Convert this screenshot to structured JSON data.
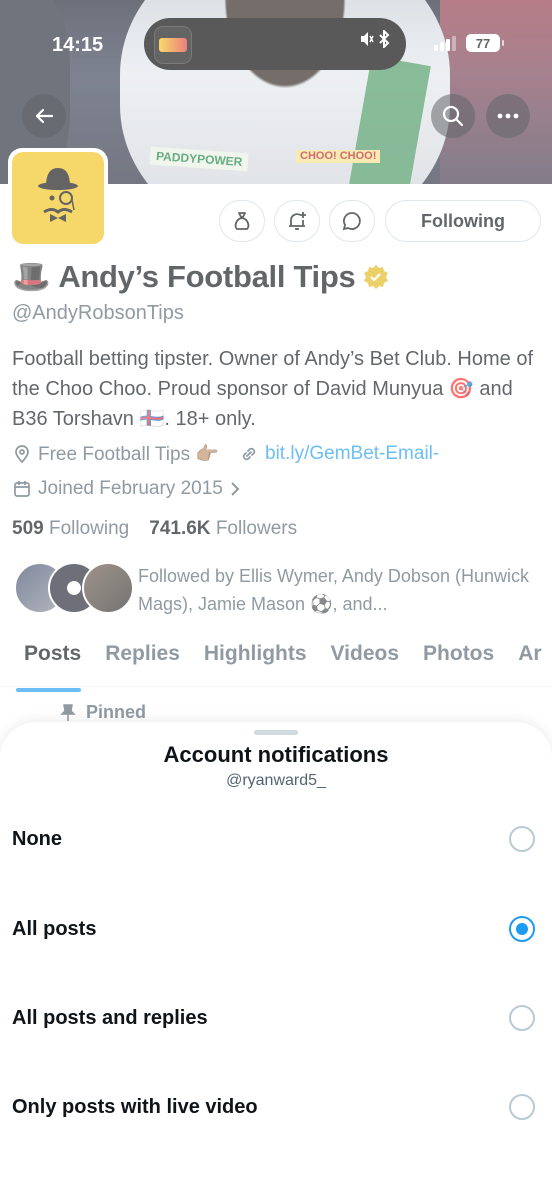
{
  "status_bar": {
    "time": "14:15",
    "battery": "77"
  },
  "profile": {
    "emoji": "🎩",
    "name": "Andy’s Football Tips",
    "handle": "@AndyRobsonTips",
    "bio": "Football betting tipster. Owner of Andy’s Bet Club. Home of the Choo Choo. Proud sponsor of David Munyua 🎯 and B36 Torshavn 🇫🇴. 18+ only.",
    "location": "Free Football Tips 👉🏽",
    "website": "bit.ly/GemBet-Email-",
    "joined": "Joined February 2015",
    "following_count": "509",
    "following_label": "Following",
    "followers_count": "741.6K",
    "followers_label": "Followers",
    "followed_by": "Followed by Ellis Wymer, Andy Dobson (Hunwick Mags), Jamie Mason ⚽, and..."
  },
  "banner": {
    "shirt_sponsor": "PADDYPOWER",
    "sign_text": "CHOO! CHOO!"
  },
  "actions": {
    "following_label": "Following"
  },
  "tabs": [
    "Posts",
    "Replies",
    "Highlights",
    "Videos",
    "Photos",
    "Ar"
  ],
  "active_tab": "Posts",
  "pinned_label": "Pinned",
  "sheet": {
    "title": "Account notifications",
    "subtitle": "@ryanward5_",
    "options": [
      {
        "label": "None",
        "selected": false
      },
      {
        "label": "All posts",
        "selected": true
      },
      {
        "label": "All posts and replies",
        "selected": false
      },
      {
        "label": "Only posts with live video",
        "selected": false
      }
    ]
  },
  "colors": {
    "accent": "#1d9bf0",
    "verified": "#e2b719",
    "avatar_bg": "#f2c31b"
  },
  "icons": [
    "back-arrow-icon",
    "search-icon",
    "more-icon",
    "money-bag-icon",
    "bell-plus-icon",
    "message-icon",
    "verified-badge-icon",
    "location-icon",
    "link-icon",
    "calendar-icon",
    "chevron-right-icon",
    "pin-icon",
    "bluetooth-icon",
    "mute-icon"
  ]
}
